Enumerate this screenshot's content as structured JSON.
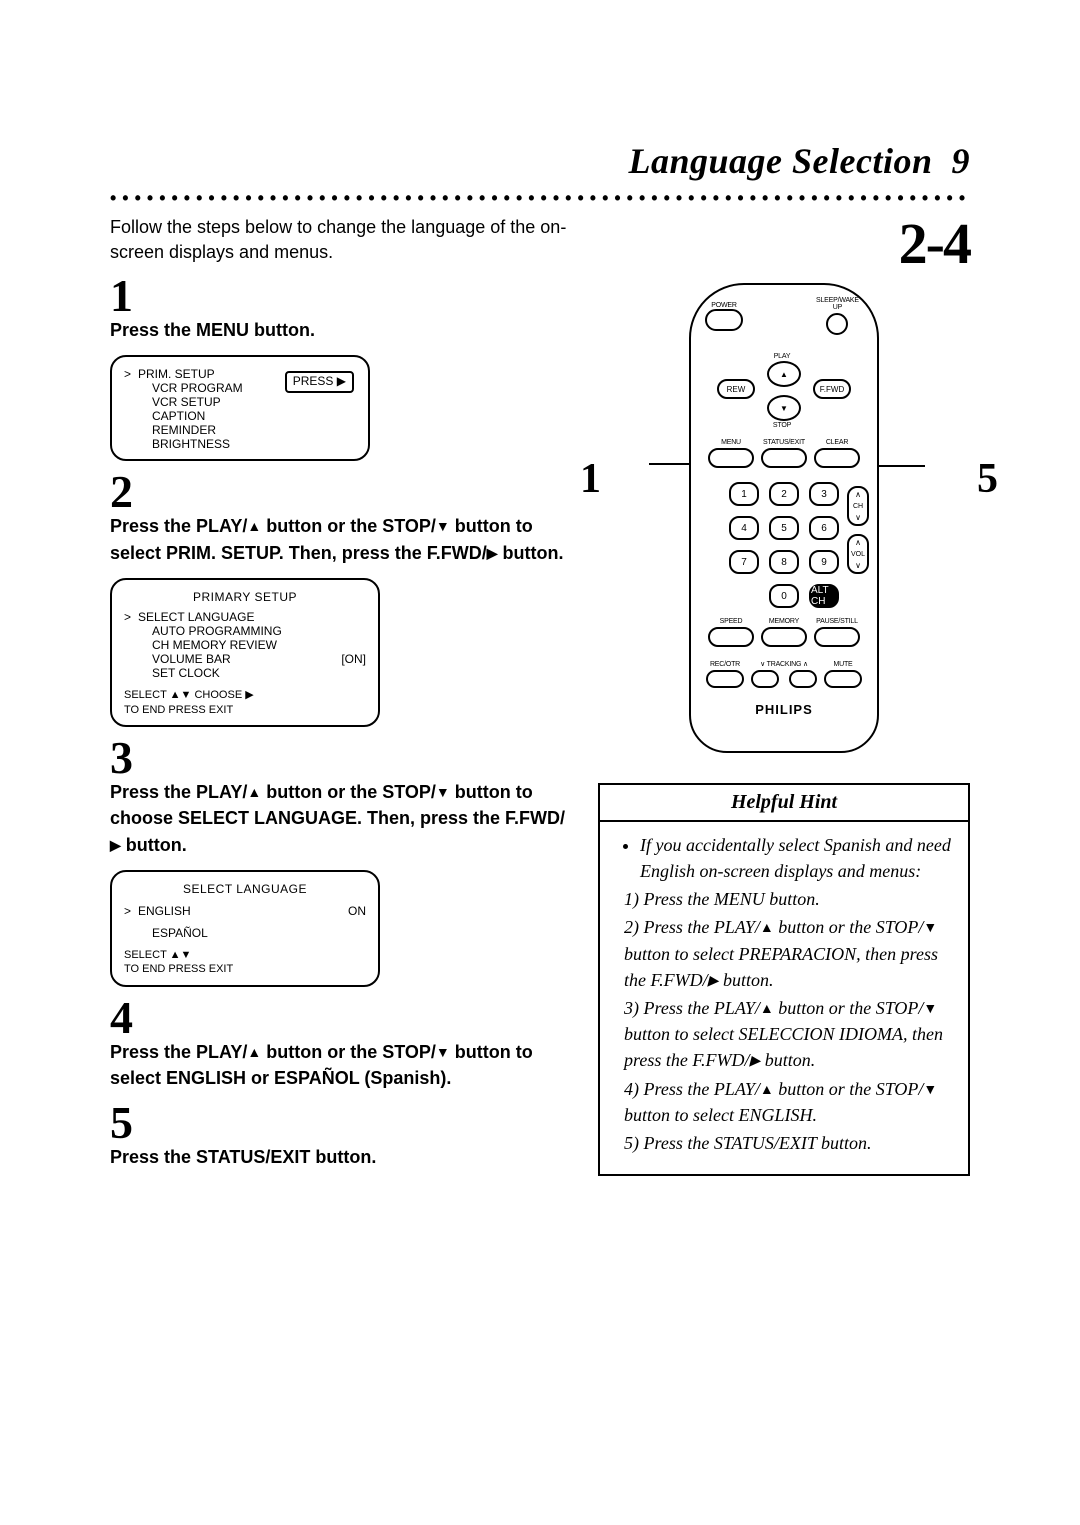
{
  "header": {
    "title": "Language Selection",
    "page_number": "9"
  },
  "intro": "Follow the steps below to change the language of the on-screen displays and menus.",
  "callouts": {
    "left_num": "1",
    "right_num": "5",
    "range": "2-4"
  },
  "steps": {
    "s1": {
      "num": "1",
      "head": "Press the MENU button."
    },
    "s2": {
      "num": "2",
      "head_a": "Press the PLAY/",
      "head_b": " button or the STOP/",
      "head_c": " button to select PRIM. SETUP. Then, press the F.FWD/",
      "head_d": " button."
    },
    "s3": {
      "num": "3",
      "head_a": "Press the PLAY/",
      "head_b": " button or the STOP/",
      "head_c": " button to choose SELECT LANGUAGE. Then, press the F.FWD/",
      "head_d": " button."
    },
    "s4": {
      "num": "4",
      "head_a": "Press the PLAY/",
      "head_b": " button or the STOP/",
      "head_c": " button to select ENGLISH or ESPAÑOL (Spanish)."
    },
    "s5": {
      "num": "5",
      "head": "Press the STATUS/EXIT button."
    }
  },
  "osd1": {
    "press": "PRESS ▶",
    "i1": "PRIM. SETUP",
    "i2": "VCR PROGRAM",
    "i3": "VCR SETUP",
    "i4": "CAPTION",
    "i5": "REMINDER",
    "i6": "BRIGHTNESS"
  },
  "osd2": {
    "title": "PRIMARY SETUP",
    "i1": "SELECT LANGUAGE",
    "i2": "AUTO PROGRAMMING",
    "i3": "CH MEMORY REVIEW",
    "i4l": "VOLUME BAR",
    "i4r": "[ON]",
    "i5": "SET CLOCK",
    "b1": "SELECT ▲▼  CHOOSE ▶",
    "b2": "TO  END  PRESS  EXIT"
  },
  "osd3": {
    "title": "SELECT LANGUAGE",
    "i1l": "ENGLISH",
    "i1r": "ON",
    "i2": "ESPAÑOL",
    "b1": "SELECT ▲▼",
    "b2": "TO  END  PRESS  EXIT"
  },
  "remote": {
    "brand": "PHILIPS",
    "power": "POWER",
    "sleep": "SLEEP/WAKE UP",
    "play": "PLAY",
    "stop": "STOP",
    "rew": "REW",
    "ffwd": "F.FWD",
    "menu": "MENU",
    "status": "STATUS/EXIT",
    "clear": "CLEAR",
    "nums": [
      "1",
      "2",
      "3",
      "4",
      "5",
      "6",
      "7",
      "8",
      "9",
      "0"
    ],
    "altch": "ALT CH",
    "ch": "CH",
    "vol": "VOL",
    "speed": "SPEED",
    "memory": "MEMORY",
    "pause": "PAUSE/STILL",
    "recotr": "REC/OTR",
    "trk_dn": "∨  TRACKING  ∧",
    "mute": "MUTE"
  },
  "hint": {
    "head": "Helpful Hint",
    "lead": "If you accidentally select Spanish and need English on-screen displays and menus:",
    "l1": "1) Press the MENU button.",
    "l2a": "2) Press the PLAY/",
    "l2b": " button or the STOP/",
    "l2c": " button to select PREPARA­CION, then press the F.FWD/",
    "l2d": " button.",
    "l3a": "3) Press the PLAY/",
    "l3b": " button or the STOP/",
    "l3c": " button to select SELEC­CION IDIOMA, then press the F.FWD/",
    "l3d": " button.",
    "l4a": "4) Press the PLAY/",
    "l4b": " button or the STOP/",
    "l4c": " button to select ENGLISH.",
    "l5": "5) Press the STATUS/EXIT button."
  }
}
